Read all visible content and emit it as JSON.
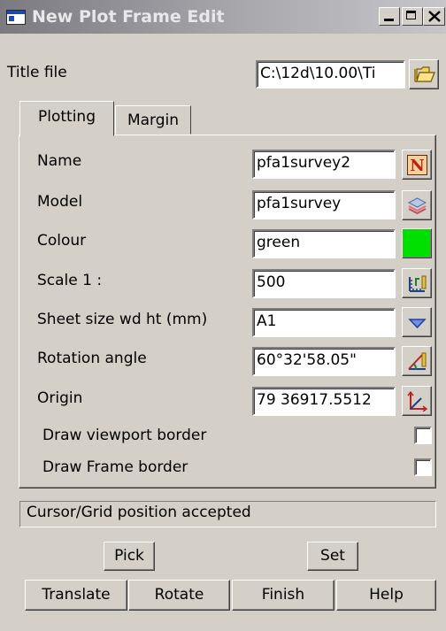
{
  "window": {
    "title": "New Plot Frame Edit"
  },
  "title_file": {
    "label": "Title file",
    "value": "C:\\12d\\10.00\\Ti"
  },
  "tabs": [
    {
      "label": "Plotting",
      "active": true
    },
    {
      "label": "Margin",
      "active": false
    }
  ],
  "fields": {
    "name": {
      "label": "Name",
      "value": "pfa1survey2"
    },
    "model": {
      "label": "Model",
      "value": "pfa1survey"
    },
    "colour": {
      "label": "Colour",
      "value": "green",
      "swatch": "#00e000"
    },
    "scale": {
      "label": "Scale 1 :",
      "value": "500"
    },
    "sheet": {
      "label": "Sheet size wd ht (mm)",
      "value": "A1"
    },
    "rotation": {
      "label": "Rotation angle",
      "value": "60°32'58.05\""
    },
    "origin": {
      "label": "Origin",
      "value": "79 36917.5512"
    }
  },
  "checks": {
    "viewport": {
      "label": "Draw viewport border",
      "checked": false
    },
    "frame": {
      "label": "Draw Frame border",
      "checked": false
    }
  },
  "status": "Cursor/Grid position accepted",
  "buttons": {
    "pick": "Pick",
    "set": "Set",
    "translate": "Translate",
    "rotate": "Rotate",
    "finish": "Finish",
    "help": "Help"
  },
  "icons": {
    "folder": "folder-icon",
    "name": "n-letter-icon",
    "model": "layers-icon",
    "scale": "scale-icon",
    "sheet": "dropdown-arrow-icon",
    "rotation": "angle-pick-icon",
    "origin": "axes-pick-icon"
  }
}
